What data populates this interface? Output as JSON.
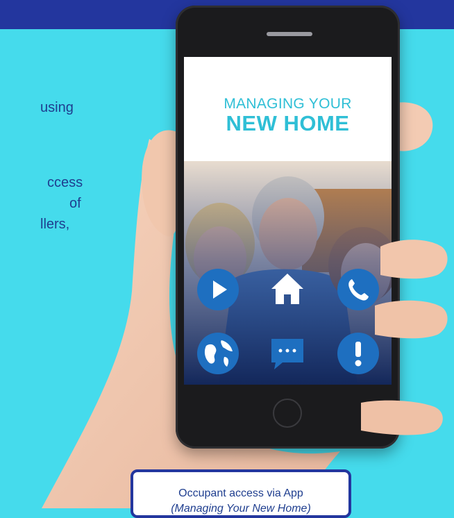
{
  "left_text": {
    "line1": "using",
    "line2": "ccess",
    "line3": "of",
    "line4": "llers,"
  },
  "screen": {
    "title_top": "MANAGING YOUR",
    "title_bottom": "NEW HOME"
  },
  "app_icons": [
    "play-icon",
    "home-icon",
    "phone-icon",
    "globe-icon",
    "message-icon",
    "alert-icon"
  ],
  "caption": {
    "line1": "Occupant access via App",
    "line2": "(Managing Your New Home)"
  },
  "colors": {
    "background": "#45dbec",
    "top_bar": "#23369e",
    "text_blue": "#1f3e8f",
    "title_cyan": "#2fbfd6",
    "icon_blue": "#1e6fc0"
  }
}
